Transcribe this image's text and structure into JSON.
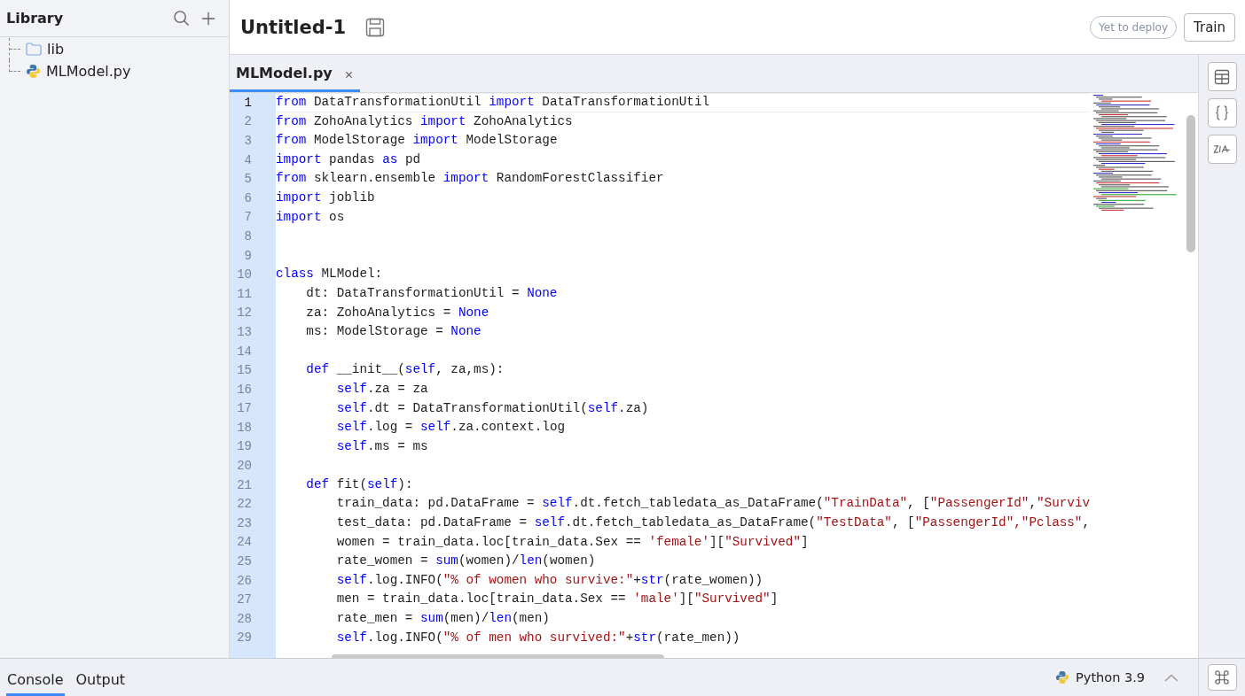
{
  "sidebar": {
    "title": "Library",
    "items": [
      {
        "label": "lib",
        "kind": "folder"
      },
      {
        "label": "MLModel.py",
        "kind": "python"
      }
    ]
  },
  "header": {
    "title": "Untitled-1",
    "status": "Yet to deploy",
    "action": "Train"
  },
  "tabs": [
    {
      "label": "MLModel.py",
      "selected": true
    }
  ],
  "code": {
    "lines": [
      {
        "number": "1",
        "current": true,
        "tokens": [
          {
            "kind": "kw",
            "text": "from"
          },
          {
            "kind": "plain",
            "text": " DataTransformationUtil "
          },
          {
            "kind": "kw",
            "text": "import"
          },
          {
            "kind": "plain",
            "text": " DataTransformationUtil"
          }
        ]
      },
      {
        "number": "2",
        "current": false,
        "tokens": [
          {
            "kind": "kw",
            "text": "from"
          },
          {
            "kind": "plain",
            "text": " ZohoAnalytics "
          },
          {
            "kind": "kw",
            "text": "import"
          },
          {
            "kind": "plain",
            "text": " ZohoAnalytics"
          }
        ]
      },
      {
        "number": "3",
        "current": false,
        "tokens": [
          {
            "kind": "kw",
            "text": "from"
          },
          {
            "kind": "plain",
            "text": " ModelStorage "
          },
          {
            "kind": "kw",
            "text": "import"
          },
          {
            "kind": "plain",
            "text": " ModelStorage"
          }
        ]
      },
      {
        "number": "4",
        "current": false,
        "tokens": [
          {
            "kind": "kw",
            "text": "import"
          },
          {
            "kind": "plain",
            "text": " pandas "
          },
          {
            "kind": "kw",
            "text": "as"
          },
          {
            "kind": "plain",
            "text": " pd"
          }
        ]
      },
      {
        "number": "5",
        "current": false,
        "tokens": [
          {
            "kind": "kw",
            "text": "from"
          },
          {
            "kind": "plain",
            "text": " sklearn.ensemble "
          },
          {
            "kind": "kw",
            "text": "import"
          },
          {
            "kind": "plain",
            "text": " RandomForestClassifier"
          }
        ]
      },
      {
        "number": "6",
        "current": false,
        "tokens": [
          {
            "kind": "kw",
            "text": "import"
          },
          {
            "kind": "plain",
            "text": " joblib"
          }
        ]
      },
      {
        "number": "7",
        "current": false,
        "tokens": [
          {
            "kind": "kw",
            "text": "import"
          },
          {
            "kind": "plain",
            "text": " os"
          }
        ]
      },
      {
        "number": "8",
        "current": false
      },
      {
        "number": "9",
        "current": false
      },
      {
        "number": "10",
        "current": false,
        "tokens": [
          {
            "kind": "kw",
            "text": "class"
          },
          {
            "kind": "plain",
            "text": " MLModel:"
          }
        ],
        "children": [
          {
            "number": "11",
            "current": false,
            "tokens": [
              {
                "kind": "plain",
                "text": "dt: DataTransformationUtil = "
              },
              {
                "kind": "kw",
                "text": "None"
              }
            ]
          },
          {
            "number": "12",
            "current": false,
            "tokens": [
              {
                "kind": "plain",
                "text": "za: ZohoAnalytics = "
              },
              {
                "kind": "kw",
                "text": "None"
              }
            ]
          },
          {
            "number": "13",
            "current": false,
            "tokens": [
              {
                "kind": "plain",
                "text": "ms: ModelStorage = "
              },
              {
                "kind": "kw",
                "text": "None"
              }
            ]
          },
          {
            "number": "14",
            "current": false
          },
          {
            "number": "15",
            "current": false,
            "tokens": [
              {
                "kind": "kw",
                "text": "def"
              },
              {
                "kind": "plain",
                "text": " __init__("
              },
              {
                "kind": "kw",
                "text": "self"
              },
              {
                "kind": "plain",
                "text": ", za,ms):"
              }
            ],
            "children": [
              {
                "number": "16",
                "current": false,
                "tokens": [
                  {
                    "kind": "kw",
                    "text": "self"
                  },
                  {
                    "kind": "plain",
                    "text": ".za = za"
                  }
                ]
              },
              {
                "number": "17",
                "current": false,
                "tokens": [
                  {
                    "kind": "kw",
                    "text": "self"
                  },
                  {
                    "kind": "plain",
                    "text": ".dt = DataTransformationUtil("
                  },
                  {
                    "kind": "kw",
                    "text": "self"
                  },
                  {
                    "kind": "plain",
                    "text": ".za)"
                  }
                ]
              },
              {
                "number": "18",
                "current": false,
                "tokens": [
                  {
                    "kind": "kw",
                    "text": "self"
                  },
                  {
                    "kind": "plain",
                    "text": ".log = "
                  },
                  {
                    "kind": "kw",
                    "text": "self"
                  },
                  {
                    "kind": "plain",
                    "text": ".za.context.log"
                  }
                ]
              },
              {
                "number": "19",
                "current": false,
                "tokens": [
                  {
                    "kind": "kw",
                    "text": "self"
                  },
                  {
                    "kind": "plain",
                    "text": ".ms = ms"
                  }
                ]
              }
            ]
          },
          {
            "number": "20",
            "current": false
          },
          {
            "number": "21",
            "current": false,
            "tokens": [
              {
                "kind": "kw",
                "text": "def"
              },
              {
                "kind": "plain",
                "text": " fit("
              },
              {
                "kind": "kw",
                "text": "self"
              },
              {
                "kind": "plain",
                "text": "):"
              }
            ],
            "children": [
              {
                "number": "22",
                "current": false,
                "tokens": [
                  {
                    "kind": "plain",
                    "text": "train_data: pd.DataFrame = "
                  },
                  {
                    "kind": "kw",
                    "text": "self"
                  },
                  {
                    "kind": "plain",
                    "text": ".dt.fetch_tabledata_as_DataFrame("
                  },
                  {
                    "kind": "str",
                    "text": "\"TrainData\""
                  },
                  {
                    "kind": "plain",
                    "text": ", ["
                  },
                  {
                    "kind": "str",
                    "text": "\"PassengerId\""
                  },
                  {
                    "kind": "plain",
                    "text": ","
                  },
                  {
                    "kind": "str",
                    "text": "\"Surviv"
                  }
                ]
              },
              {
                "number": "23",
                "current": false,
                "tokens": [
                  {
                    "kind": "plain",
                    "text": "test_data: pd.DataFrame = "
                  },
                  {
                    "kind": "kw",
                    "text": "self"
                  },
                  {
                    "kind": "plain",
                    "text": ".dt.fetch_tabledata_as_DataFrame("
                  },
                  {
                    "kind": "str",
                    "text": "\"TestData\""
                  },
                  {
                    "kind": "plain",
                    "text": ", ["
                  },
                  {
                    "kind": "str",
                    "text": "\"PassengerId\",\"Pclass\""
                  },
                  {
                    "kind": "plain",
                    "text": ","
                  }
                ]
              },
              {
                "number": "24",
                "current": false,
                "tokens": [
                  {
                    "kind": "plain",
                    "text": "women = train_data.loc[train_data.Sex == "
                  },
                  {
                    "kind": "str",
                    "text": "'female'"
                  },
                  {
                    "kind": "plain",
                    "text": "]["
                  },
                  {
                    "kind": "str",
                    "text": "\"Survived\""
                  },
                  {
                    "kind": "plain",
                    "text": "]"
                  }
                ]
              },
              {
                "number": "25",
                "current": false,
                "tokens": [
                  {
                    "kind": "plain",
                    "text": "rate_women = "
                  },
                  {
                    "kind": "kw",
                    "text": "sum"
                  },
                  {
                    "kind": "plain",
                    "text": "(women)/"
                  },
                  {
                    "kind": "kw",
                    "text": "len"
                  },
                  {
                    "kind": "plain",
                    "text": "(women)"
                  }
                ]
              },
              {
                "number": "26",
                "current": false,
                "tokens": [
                  {
                    "kind": "kw",
                    "text": "self"
                  },
                  {
                    "kind": "plain",
                    "text": ".log.INFO("
                  },
                  {
                    "kind": "str",
                    "text": "\"% of women who survive:\""
                  },
                  {
                    "kind": "plain",
                    "text": "+"
                  },
                  {
                    "kind": "kw",
                    "text": "str"
                  },
                  {
                    "kind": "plain",
                    "text": "(rate_women))"
                  }
                ]
              },
              {
                "number": "27",
                "current": false,
                "tokens": [
                  {
                    "kind": "plain",
                    "text": "men = train_data.loc[train_data.Sex == "
                  },
                  {
                    "kind": "str",
                    "text": "'male'"
                  },
                  {
                    "kind": "plain",
                    "text": "]["
                  },
                  {
                    "kind": "str",
                    "text": "\"Survived\""
                  },
                  {
                    "kind": "plain",
                    "text": "]"
                  }
                ]
              },
              {
                "number": "28",
                "current": false,
                "tokens": [
                  {
                    "kind": "plain",
                    "text": "rate_men = "
                  },
                  {
                    "kind": "kw",
                    "text": "sum"
                  },
                  {
                    "kind": "plain",
                    "text": "(men)/"
                  },
                  {
                    "kind": "kw",
                    "text": "len"
                  },
                  {
                    "kind": "plain",
                    "text": "(men)"
                  }
                ]
              },
              {
                "number": "29",
                "current": false,
                "tokens": [
                  {
                    "kind": "kw",
                    "text": "self"
                  },
                  {
                    "kind": "plain",
                    "text": ".log.INFO("
                  },
                  {
                    "kind": "str",
                    "text": "\"% of men who survived:\""
                  },
                  {
                    "kind": "plain",
                    "text": "+"
                  },
                  {
                    "kind": "kw",
                    "text": "str"
                  },
                  {
                    "kind": "plain",
                    "text": "(rate_men))"
                  }
                ]
              }
            ]
          }
        ]
      }
    ]
  },
  "bottom": {
    "tabs": [
      {
        "label": "Console",
        "selected": true
      },
      {
        "label": "Output",
        "selected": false
      }
    ],
    "runtime": "Python 3.9"
  }
}
